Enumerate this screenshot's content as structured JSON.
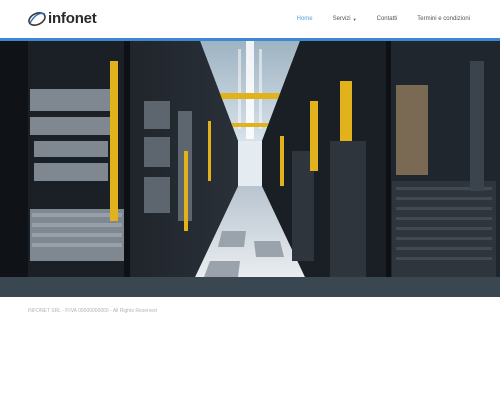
{
  "brand": {
    "name": "infonet",
    "logo_icon": "swoosh-logo-icon",
    "logo_color": "#2a2a2a"
  },
  "nav": {
    "items": [
      {
        "label": "Home",
        "active": true
      },
      {
        "label": "Servizi",
        "has_dropdown": true
      },
      {
        "label": "Contatti"
      },
      {
        "label": "Termini e condizioni"
      }
    ]
  },
  "hero": {
    "image": "server-room-corridor"
  },
  "footer": {
    "text": "INFONET SRL - P.IVA 00000000000 - All Rights Reserved"
  },
  "colors": {
    "accent": "#3f86d4",
    "active_link": "#5aa0e0",
    "band": "#3a4650",
    "footer_text": "#b3b3b3"
  }
}
